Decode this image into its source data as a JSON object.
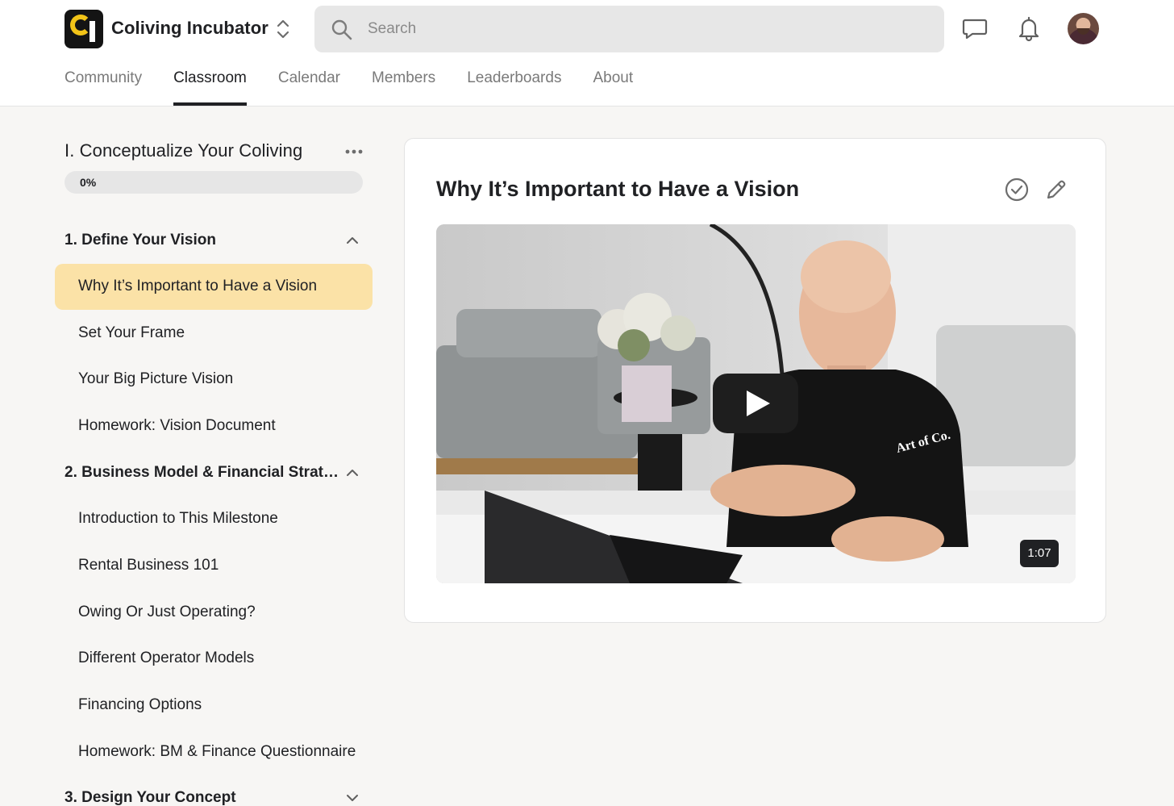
{
  "header": {
    "community_name": "Coliving Incubator",
    "logo_icon": "coliving-incubator-logo",
    "search": {
      "placeholder": "Search",
      "value": ""
    },
    "icons": [
      "chat-icon",
      "bell-icon",
      "avatar"
    ]
  },
  "tabs": [
    {
      "label": "Community",
      "active": false
    },
    {
      "label": "Classroom",
      "active": true
    },
    {
      "label": "Calendar",
      "active": false
    },
    {
      "label": "Members",
      "active": false
    },
    {
      "label": "Leaderboards",
      "active": false
    },
    {
      "label": "About",
      "active": false
    }
  ],
  "sidebar": {
    "course_title": "I. Conceptualize Your Coliving",
    "progress": {
      "label": "0%",
      "value": 0
    },
    "modules": [
      {
        "title": "1. Define Your Vision",
        "expanded": true,
        "lessons": [
          "Why It’s Important to Have a Vision",
          "Set Your Frame",
          "Your Big Picture Vision",
          "Homework: Vision Document"
        ]
      },
      {
        "title": "2. Business Model & Financial Strat…",
        "expanded": true,
        "lessons": [
          "Introduction to This Milestone",
          "Rental Business 101",
          "Owing Or Just Operating?",
          "Different Operator Models",
          "Financing Options",
          "Homework: BM & Finance Questionnaire"
        ]
      },
      {
        "title": "3. Design Your Concept",
        "expanded": false,
        "lessons": []
      }
    ],
    "active_lesson": "Why It’s Important to Have a Vision"
  },
  "lesson": {
    "title": "Why It’s Important to Have a Vision",
    "video": {
      "duration": "1:07",
      "shirt_text": "Art of Co."
    }
  },
  "colors": {
    "accent": "#f2c418",
    "active_lesson_bg": "#fbe2a7",
    "page_bg": "#f7f6f4"
  }
}
